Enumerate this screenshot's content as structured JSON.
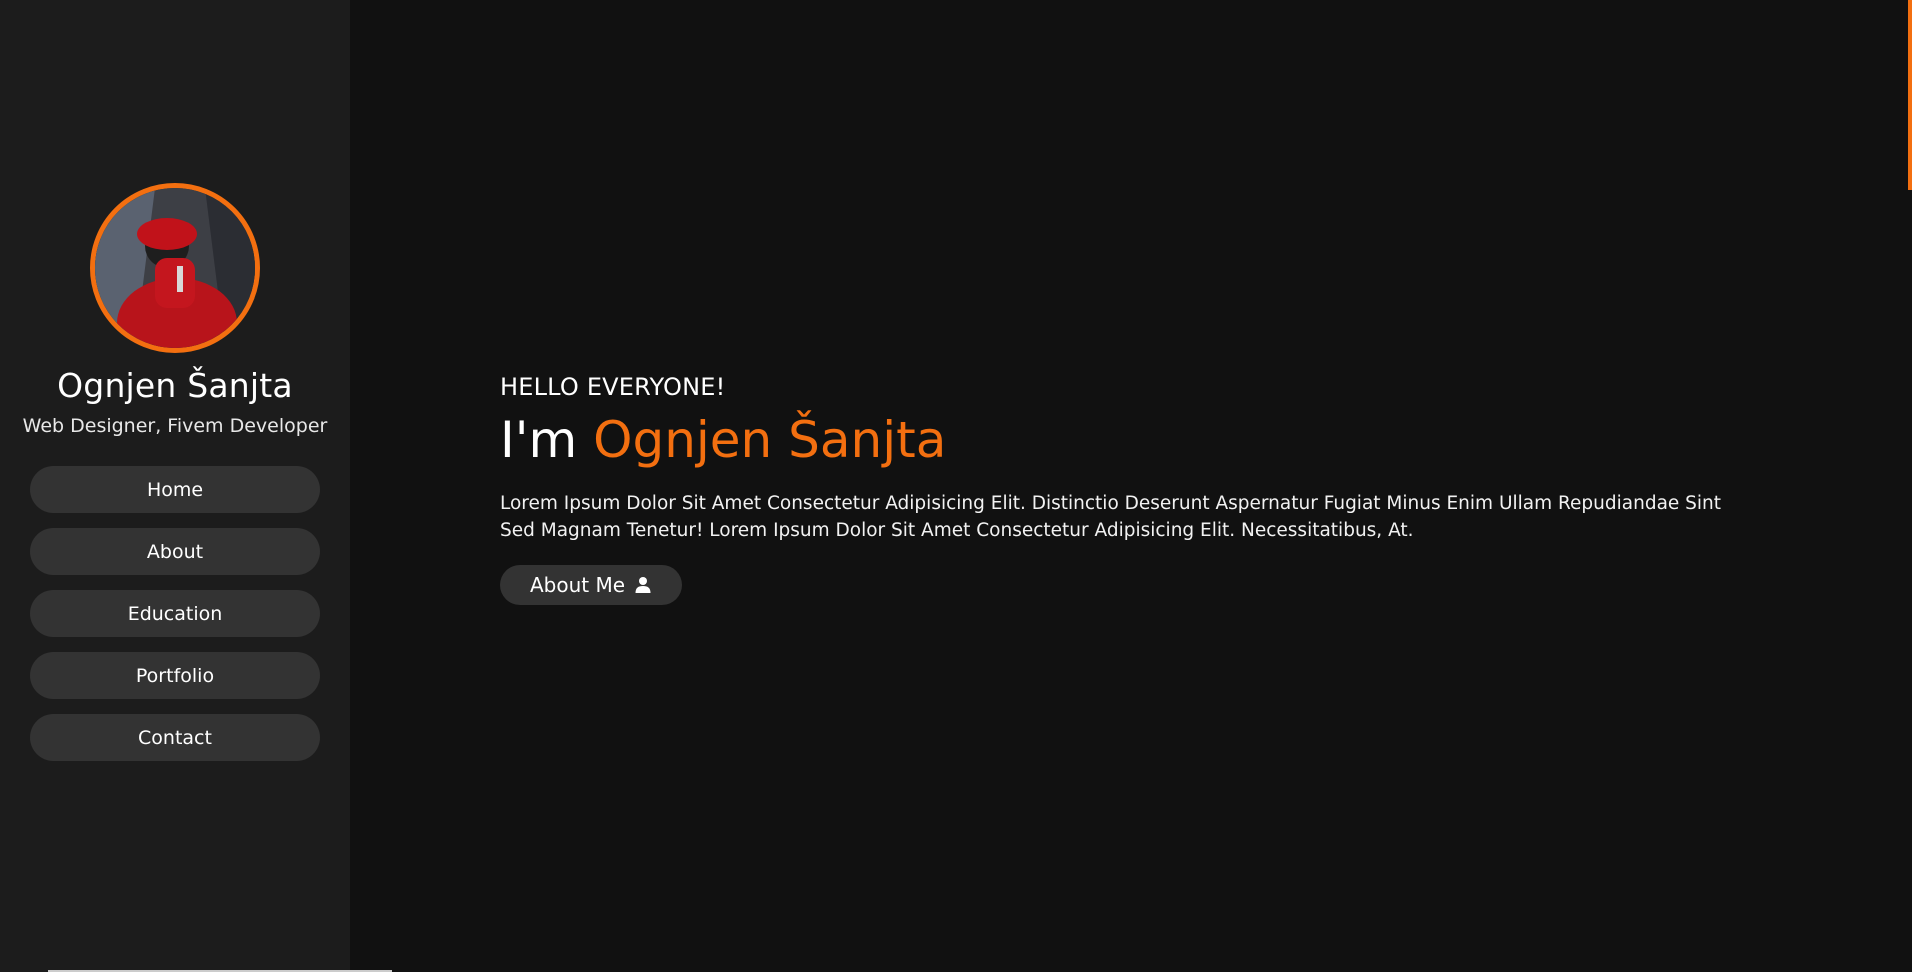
{
  "sidebar": {
    "name": "Ognjen Šanjta",
    "role": "Web Designer, Fivem Developer",
    "nav": [
      "Home",
      "About",
      "Education",
      "Portfolio",
      "Contact"
    ]
  },
  "hero": {
    "greeting": "HELLO EVERYONE!",
    "headline_prefix": "I'm",
    "headline_name": "Ognjen Šanjta",
    "description": "Lorem Ipsum Dolor Sit Amet Consectetur Adipisicing Elit. Distinctio Deserunt Aspernatur Fugiat Minus Enim Ullam Repudiandae Sint Sed Magnam Tenetur! Lorem Ipsum Dolor Sit Amet Consectetur Adipisicing Elit. Necessitatibus, At.",
    "button_label": "About Me",
    "button_icon": "user-icon"
  },
  "colors": {
    "accent": "#f36f10",
    "background": "#111111",
    "sidebar": "#1c1c1c",
    "button": "#333333"
  }
}
